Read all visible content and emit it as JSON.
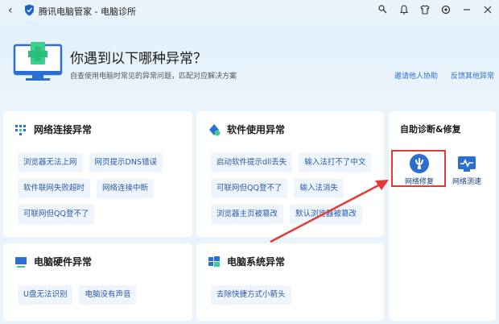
{
  "window": {
    "title": "腾讯电脑管家 - 电脑诊所"
  },
  "header": {
    "title": "你遇到以下哪种异常？",
    "subtitle": "自查使用电脑时常见的异常问题，匹配对应解决方案",
    "links": [
      "邀请他人协助",
      "反馈其他异常"
    ]
  },
  "cards": {
    "network": {
      "title": "网络连接异常",
      "chips": [
        "浏览器无法上网",
        "网页提示DNS错误",
        "软件联网失败超时",
        "网络连接中断",
        "可联网但QQ登不了"
      ]
    },
    "software": {
      "title": "软件使用异常",
      "chips": [
        "启动软件提示dll丢失",
        "输入法打不了中文",
        "可联网但QQ登不了",
        "输入法消失",
        "浏览器主页被篡改",
        "默认浏览器被篡改"
      ]
    },
    "hardware": {
      "title": "电脑硬件异常",
      "chips": [
        "U盘无法识别",
        "电脑没有声音"
      ]
    },
    "system": {
      "title": "电脑系统异常",
      "chips": [
        "去除快捷方式小箭头"
      ]
    },
    "self_repair": {
      "title": "自助诊断&修复",
      "tools": [
        {
          "label": "网络修复",
          "icon": "network-repair-icon"
        },
        {
          "label": "网络测速",
          "icon": "speed-test-icon"
        }
      ]
    }
  },
  "colors": {
    "accent": "#2b6fd1",
    "chip_bg": "#eef5fc",
    "highlight": "#e53935"
  }
}
